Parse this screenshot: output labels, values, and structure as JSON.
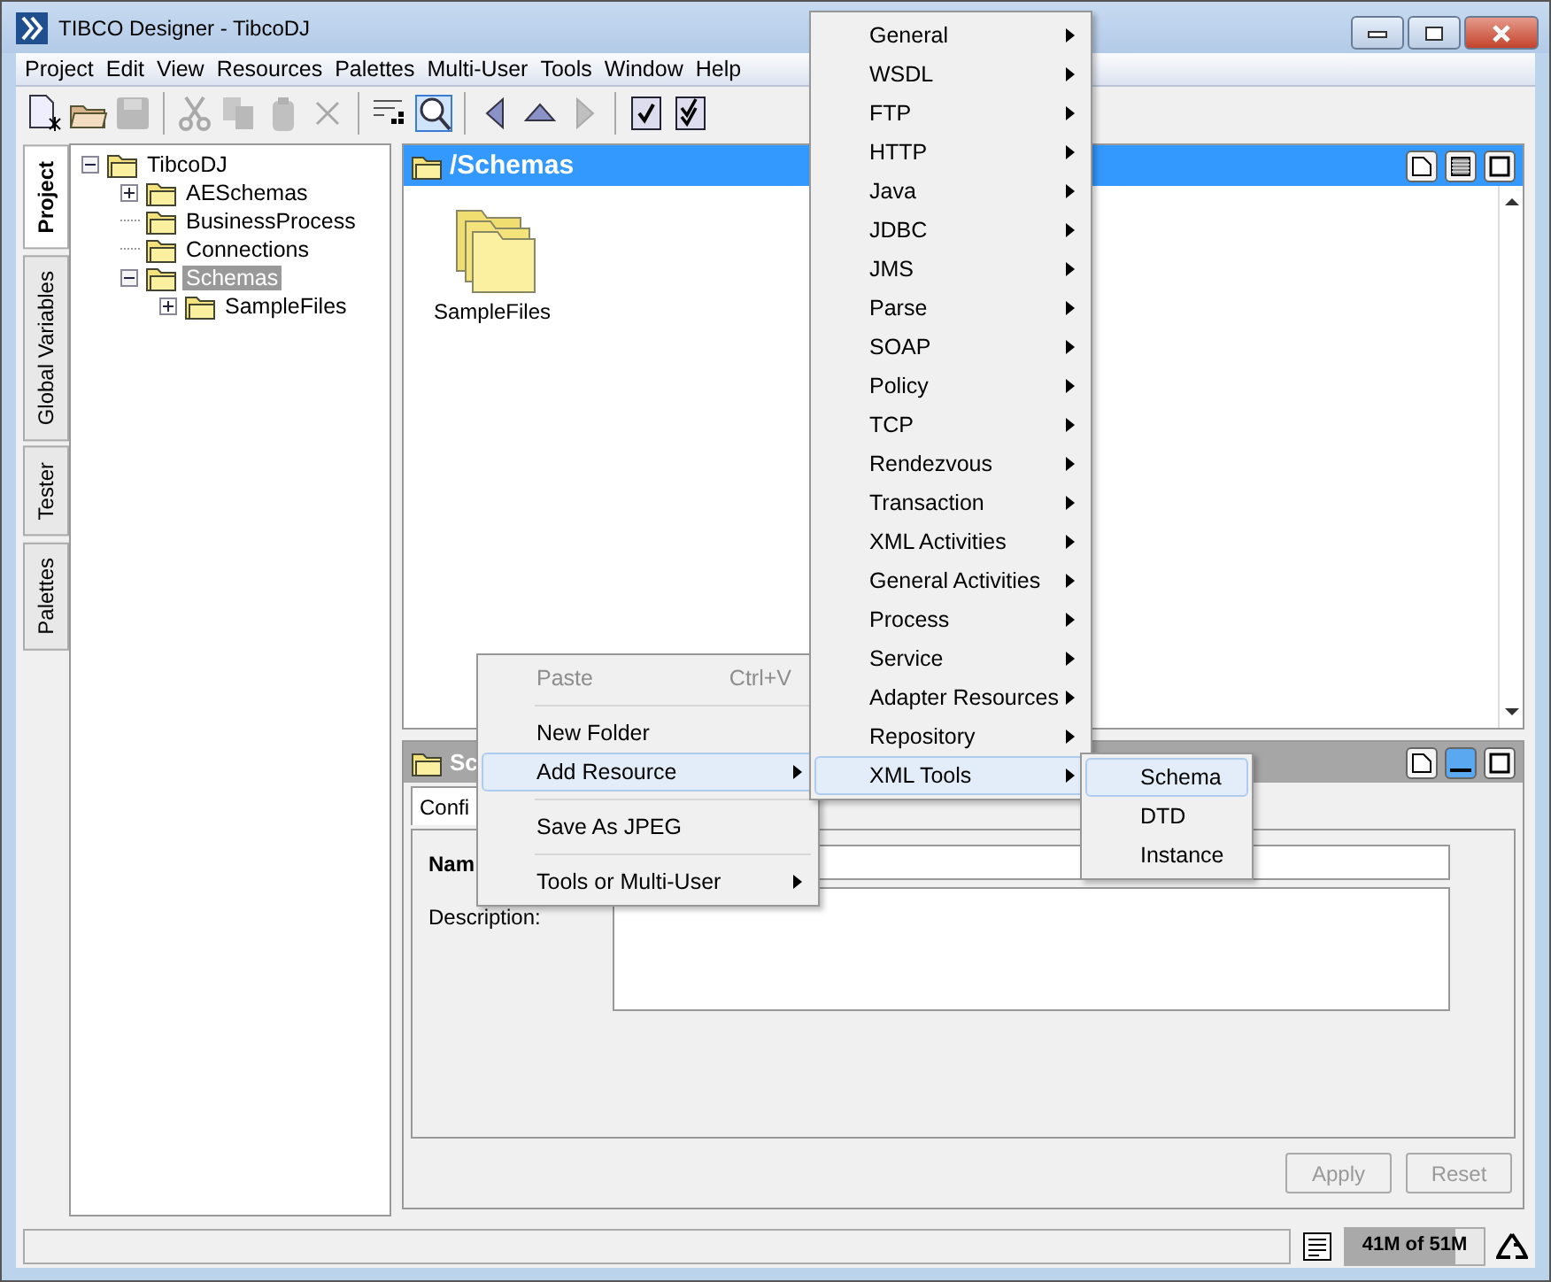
{
  "window": {
    "title": "TIBCO Designer - TibcoDJ"
  },
  "menu_bar": [
    "Project",
    "Edit",
    "View",
    "Resources",
    "Palettes",
    "Multi-User",
    "Tools",
    "Window",
    "Help"
  ],
  "toolbar": [
    {
      "kind": "new",
      "disabled": false
    },
    {
      "kind": "open",
      "disabled": false
    },
    {
      "kind": "save",
      "disabled": true
    },
    {
      "kind": "sep"
    },
    {
      "kind": "cut",
      "disabled": true
    },
    {
      "kind": "copy",
      "disabled": true
    },
    {
      "kind": "paste",
      "disabled": true
    },
    {
      "kind": "delete",
      "disabled": true
    },
    {
      "kind": "sep"
    },
    {
      "kind": "layout",
      "disabled": false
    },
    {
      "kind": "find",
      "disabled": false
    },
    {
      "kind": "sep"
    },
    {
      "kind": "back",
      "disabled": false
    },
    {
      "kind": "up",
      "disabled": false
    },
    {
      "kind": "forward",
      "disabled": true
    },
    {
      "kind": "sep"
    },
    {
      "kind": "validate",
      "disabled": false
    },
    {
      "kind": "validate-all",
      "disabled": false
    }
  ],
  "side_tabs": [
    {
      "label": "Project",
      "selected": true
    },
    {
      "label": "Global Variables",
      "selected": false
    },
    {
      "label": "Tester",
      "selected": false
    },
    {
      "label": "Palettes",
      "selected": false
    }
  ],
  "tree": [
    {
      "label": "TibcoDJ",
      "expanded": true,
      "selected": false,
      "children": [
        {
          "label": "AESchemas",
          "expanded": false,
          "selected": false
        },
        {
          "label": "BusinessProcess",
          "selected": false
        },
        {
          "label": "Connections",
          "selected": false
        },
        {
          "label": "Schemas",
          "expanded": true,
          "selected": true,
          "children": [
            {
              "label": "SampleFiles",
              "expanded": false,
              "selected": false
            }
          ]
        }
      ]
    }
  ],
  "design_panel": {
    "title": "/Schemas",
    "header_buttons": [
      {
        "kind": "page",
        "pressed": false
      },
      {
        "kind": "grid",
        "pressed": false
      },
      {
        "kind": "window",
        "pressed": false
      }
    ],
    "items": [
      {
        "label": "SampleFiles"
      }
    ]
  },
  "config_panel": {
    "title": "Sc",
    "header_buttons": [
      {
        "kind": "page",
        "pressed": false
      },
      {
        "kind": "minimize",
        "pressed": true
      },
      {
        "kind": "window",
        "pressed": false
      }
    ],
    "tabs": [
      {
        "label": "Confi",
        "selected": true
      }
    ],
    "name_label": "Nam",
    "description_label": "Description:",
    "buttons": [
      {
        "label": "Apply",
        "disabled": true
      },
      {
        "label": "Reset",
        "disabled": true
      }
    ]
  },
  "status_bar": {
    "memory": {
      "text": "41M of 51M",
      "level": 0.8
    }
  },
  "context_menu": [
    {
      "kind": "item",
      "label": "Paste",
      "shortcut": "Ctrl+V",
      "disabled": true,
      "selected": false,
      "submenu": false
    },
    {
      "kind": "separator"
    },
    {
      "kind": "item",
      "label": "New Folder",
      "disabled": false,
      "selected": false,
      "submenu": false
    },
    {
      "kind": "item",
      "label": "Add Resource",
      "disabled": false,
      "selected": true,
      "submenu": true
    },
    {
      "kind": "separator"
    },
    {
      "kind": "item",
      "label": "Save As JPEG",
      "disabled": false,
      "selected": false,
      "submenu": false
    },
    {
      "kind": "separator"
    },
    {
      "kind": "item",
      "label": "Tools or Multi-User",
      "disabled": false,
      "selected": false,
      "submenu": true
    }
  ],
  "resource_menu": [
    {
      "label": "General",
      "selected": false
    },
    {
      "label": "WSDL",
      "selected": false
    },
    {
      "label": "FTP",
      "selected": false
    },
    {
      "label": "HTTP",
      "selected": false
    },
    {
      "label": "Java",
      "selected": false
    },
    {
      "label": "JDBC",
      "selected": false
    },
    {
      "label": "JMS",
      "selected": false
    },
    {
      "label": "Parse",
      "selected": false
    },
    {
      "label": "SOAP",
      "selected": false
    },
    {
      "label": "Policy",
      "selected": false
    },
    {
      "label": "TCP",
      "selected": false
    },
    {
      "label": "Rendezvous",
      "selected": false
    },
    {
      "label": "Transaction",
      "selected": false
    },
    {
      "label": "XML Activities",
      "selected": false
    },
    {
      "label": "General Activities",
      "selected": false
    },
    {
      "label": "Process",
      "selected": false
    },
    {
      "label": "Service",
      "selected": false
    },
    {
      "label": "Adapter Resources",
      "selected": false
    },
    {
      "label": "Repository",
      "selected": false
    },
    {
      "label": "XML Tools",
      "selected": true
    }
  ],
  "xml_tools_menu": [
    {
      "label": "Schema",
      "selected": true
    },
    {
      "label": "DTD",
      "selected": false
    },
    {
      "label": "Instance",
      "selected": false
    }
  ]
}
